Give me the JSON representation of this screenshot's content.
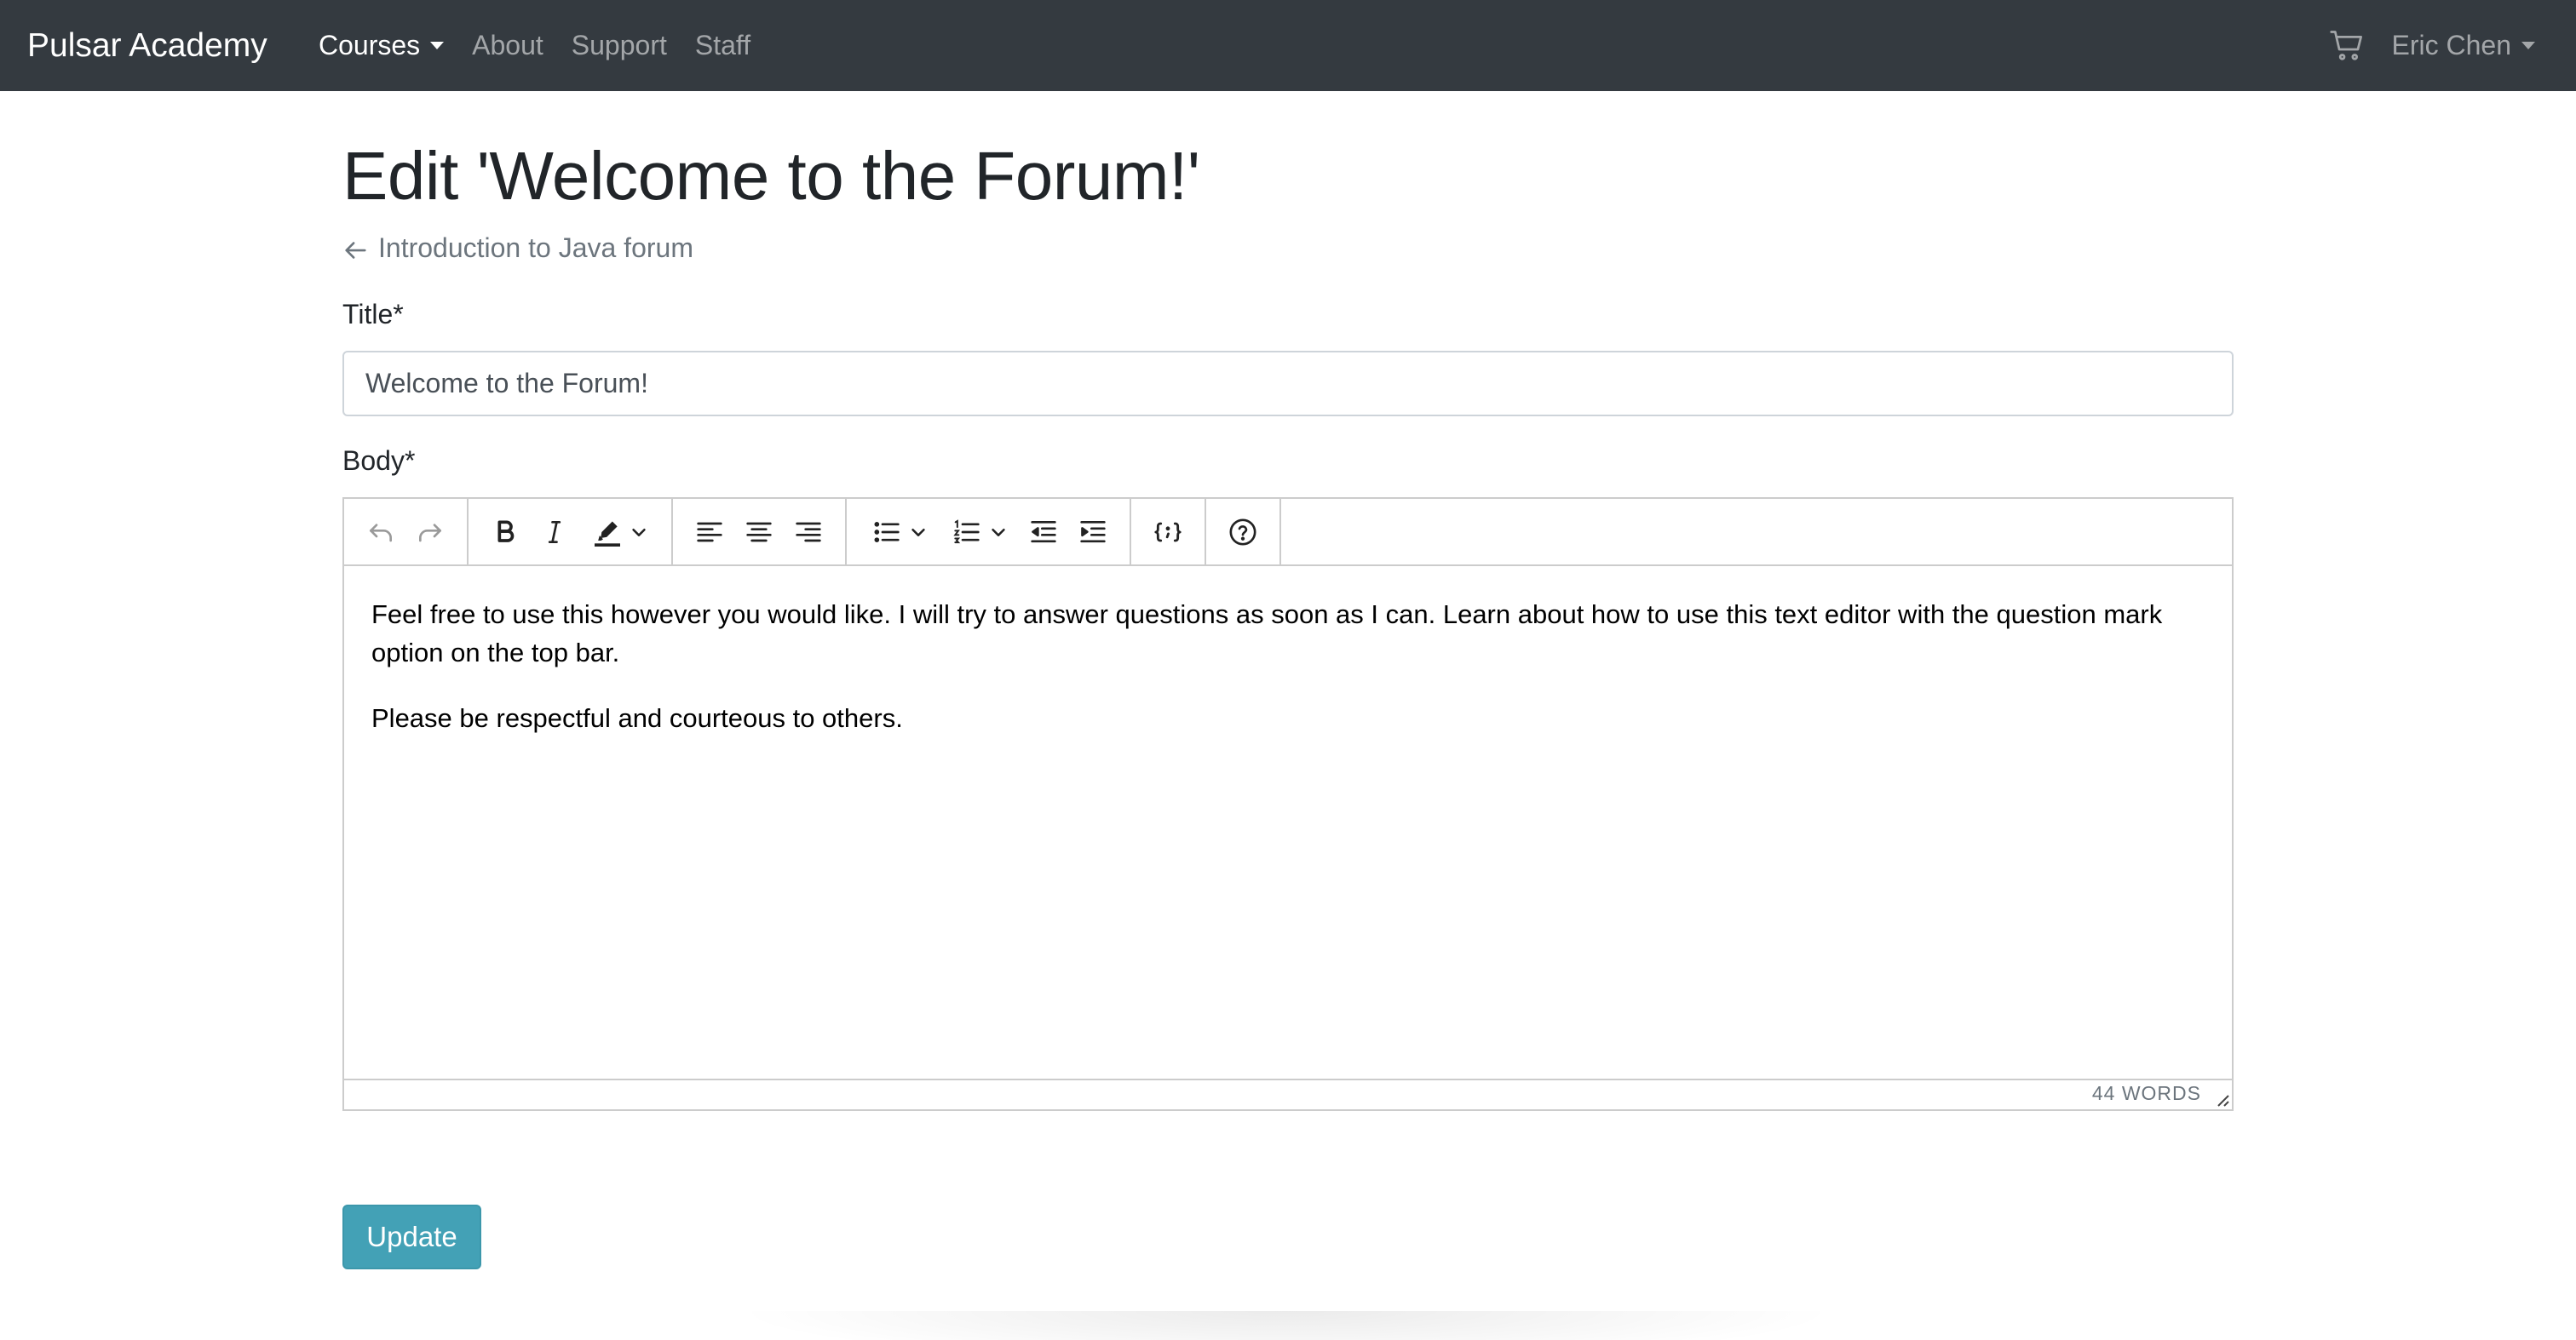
{
  "navbar": {
    "brand": "Pulsar Academy",
    "links": [
      {
        "label": "Courses",
        "active": true,
        "dropdown": true
      },
      {
        "label": "About",
        "active": false
      },
      {
        "label": "Support",
        "active": false
      },
      {
        "label": "Staff",
        "active": false
      }
    ],
    "cart_icon": "cart-icon",
    "user": "Eric Chen"
  },
  "page": {
    "title": "Edit 'Welcome to the Forum!'",
    "back_link": "Introduction to Java forum"
  },
  "form": {
    "title_label": "Title*",
    "title_value": "Welcome to the Forum!",
    "body_label": "Body*",
    "editor": {
      "toolbar_groups": [
        [
          "undo-icon",
          "redo-icon"
        ],
        [
          "bold-icon",
          "italic-icon",
          "highlight-icon"
        ],
        [
          "align-left-icon",
          "align-center-icon",
          "align-right-icon"
        ],
        [
          "bullet-list-icon",
          "numbered-list-icon",
          "outdent-icon",
          "indent-icon"
        ],
        [
          "code-sample-icon"
        ],
        [
          "help-icon"
        ]
      ],
      "paragraphs": [
        "Feel free to use this however you would like. I will try to answer questions as soon as I can. Learn about how to use this text editor with the question mark option on the top bar.",
        "Please be respectful and courteous to others."
      ],
      "word_count": "44 WORDS"
    },
    "submit_label": "Update"
  },
  "colors": {
    "navbar_bg": "#343a40",
    "primary_button": "#43a1b6"
  }
}
